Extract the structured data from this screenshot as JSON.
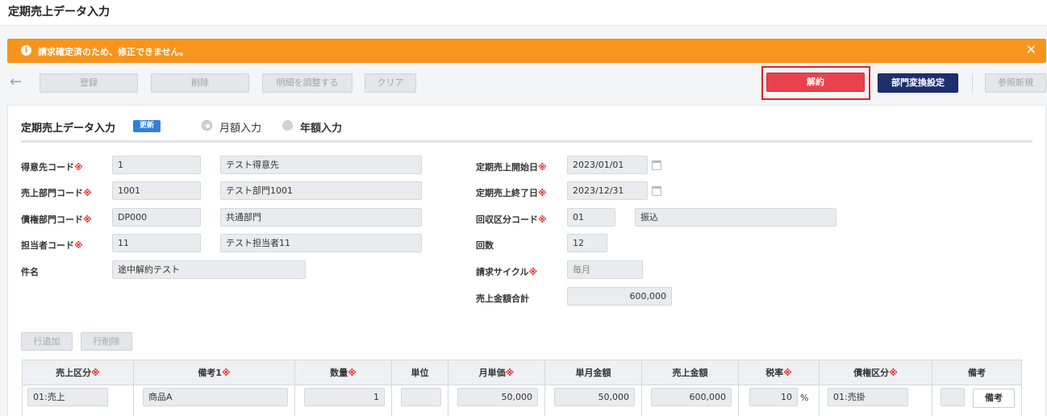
{
  "page": {
    "title": "定期売上データ入力"
  },
  "alert": {
    "message": "請求確定済のため、修正できません。",
    "icon": "i",
    "close": "✕"
  },
  "toolbar": {
    "back_icon": "←",
    "register": "登録",
    "delete": "削除",
    "adjust_details": "明細を調整する",
    "clear": "クリア",
    "cancel_contract": "解約",
    "dept_conversion": "部門変換設定",
    "new_reference": "参照新規"
  },
  "form": {
    "title": "定期売上データ入力",
    "badge": "更新",
    "radio_monthly": "月額入力",
    "radio_annual": "年額入力",
    "required_mark": "※",
    "labels": {
      "customer_code": "得意先コード",
      "sales_dept_code": "売上部門コード",
      "claim_dept_code": "債権部門コード",
      "staff_code": "担当者コード",
      "subject": "件名",
      "start_date": "定期売上開始日",
      "end_date": "定期売上終了日",
      "collection_code": "回収区分コード",
      "count": "回数",
      "billing_cycle": "請求サイクル",
      "sales_total": "売上金額合計"
    },
    "values": {
      "customer_code": "1",
      "customer_name": "テスト得意先",
      "sales_dept_code": "1001",
      "sales_dept_name": "テスト部門1001",
      "claim_dept_code": "DP000",
      "claim_dept_name": "共通部門",
      "staff_code": "11",
      "staff_name": "テスト担当者11",
      "subject": "途中解約テスト",
      "start_date": "2023/01/01",
      "end_date": "2023/12/31",
      "collection_code": "01",
      "collection_name": "振込",
      "count": "12",
      "billing_cycle": "毎月",
      "sales_total": "600,000"
    }
  },
  "grid": {
    "add_row": "行追加",
    "delete_row": "行削除",
    "headers": {
      "sales_type": "売上区分",
      "note1": "備考1",
      "quantity": "数量",
      "unit": "単位",
      "monthly_price": "月単価",
      "monthly_amount": "単月金額",
      "sales_amount": "売上金額",
      "tax_rate": "税率",
      "claim_type": "債権区分",
      "memo": "備考"
    },
    "row": {
      "sales_type": "01:売上",
      "note1": "商品A",
      "quantity": "1",
      "unit": "",
      "monthly_price": "50,000",
      "monthly_amount": "50,000",
      "sales_amount": "600,000",
      "tax_rate": "10",
      "tax_unit": "%",
      "claim_type": "01:売掛",
      "memo_button": "備考"
    }
  },
  "colors": {
    "alert": "#f7941d",
    "cancel": "#e8424c",
    "navy": "#1e2f6e",
    "badge": "#2f7fd8",
    "required": "#e0282e"
  }
}
